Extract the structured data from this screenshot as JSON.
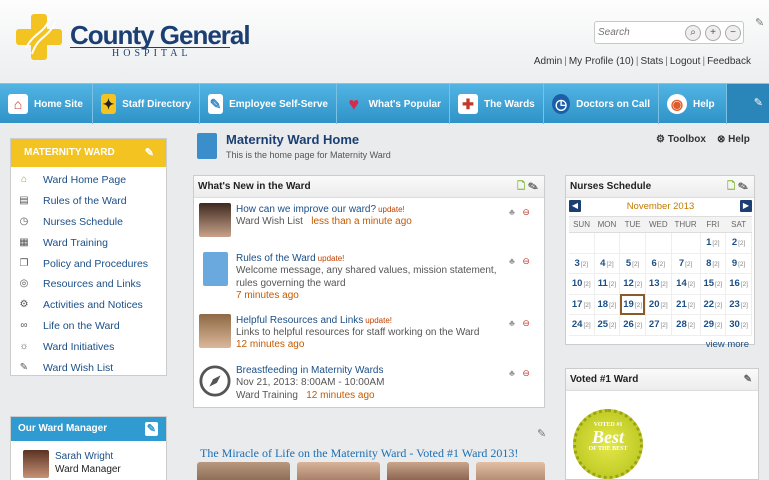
{
  "brand": {
    "name_line1": "County General",
    "name_line2": "HOSPITAL",
    "logo_color": "#f3c321"
  },
  "search": {
    "placeholder": "Search"
  },
  "user_links": [
    "Admin",
    "My Profile (10)",
    "Stats",
    "Logout",
    "Feedback"
  ],
  "nav": {
    "items": [
      {
        "label": "Home Site",
        "icon": "house-icon"
      },
      {
        "label": "Staff Directory",
        "icon": "person-walking-icon"
      },
      {
        "label": "Employee Self-Serve",
        "icon": "pencil-paper-icon"
      },
      {
        "label": "What's Popular",
        "icon": "heart-icon"
      },
      {
        "label": "The Wards",
        "icon": "medical-kit-icon"
      },
      {
        "label": "Doctors on Call",
        "icon": "clock-icon"
      },
      {
        "label": "Help",
        "icon": "lifebuoy-icon"
      }
    ]
  },
  "ward_menu": {
    "title": "MATERNITY WARD",
    "items": [
      {
        "label": "Ward Home Page",
        "icon": "home-icon"
      },
      {
        "label": "Rules of the Ward",
        "icon": "document-icon"
      },
      {
        "label": "Nurses Schedule",
        "icon": "clock-icon"
      },
      {
        "label": "Ward Training",
        "icon": "calendar-icon"
      },
      {
        "label": "Policy and Procedures",
        "icon": "stack-icon"
      },
      {
        "label": "Resources and Links",
        "icon": "globe-icon"
      },
      {
        "label": "Activities and Notices",
        "icon": "gear-icon"
      },
      {
        "label": "Life on the Ward",
        "icon": "binoculars-icon"
      },
      {
        "label": "Ward Initiatives",
        "icon": "sun-icon"
      },
      {
        "label": "Ward Wish List",
        "icon": "pencil-icon"
      }
    ]
  },
  "ward_manager": {
    "title": "Our Ward Manager",
    "name": "Sarah Wright",
    "role": "Ward Manager"
  },
  "page": {
    "title": "Maternity Ward Home",
    "subtitle": "This is the home page for Maternity Ward",
    "toolbox_label": "Toolbox",
    "help_label": "Help"
  },
  "whats_new": {
    "title": "What's New in the Ward",
    "update_tag": "update!",
    "items": [
      {
        "title": "How can we improve our ward?",
        "updated": true,
        "meta": "Ward Wish List",
        "time": "less than a minute ago",
        "time_inline": true
      },
      {
        "title": "Rules of the Ward",
        "updated": true,
        "meta": "Welcome message, any shared values, mission statement, rules governing the ward",
        "time": "7 minutes ago",
        "time_inline": false
      },
      {
        "title": "Helpful Resources and Links",
        "updated": true,
        "meta": "Links to helpful resources for staff working on the Ward",
        "time": "12 minutes ago",
        "time_inline": false
      },
      {
        "title": "Breastfeeding in Maternity Wards",
        "updated": false,
        "meta": "Nov 21, 2013: 8:00AM - 10:00AM",
        "meta2": "Ward Training",
        "time": "12 minutes ago",
        "time_inline": true
      }
    ]
  },
  "nurses_schedule": {
    "title": "Nurses Schedule",
    "month": "November 2013",
    "days": [
      "SUN",
      "MON",
      "TUE",
      "WED",
      "THUR",
      "FRI",
      "SAT"
    ],
    "today": 19,
    "weeks": [
      [
        null,
        null,
        null,
        null,
        null,
        1,
        2
      ],
      [
        3,
        4,
        5,
        6,
        7,
        8,
        9
      ],
      [
        10,
        11,
        12,
        13,
        14,
        15,
        16
      ],
      [
        17,
        18,
        19,
        20,
        21,
        22,
        23
      ],
      [
        24,
        25,
        26,
        27,
        28,
        29,
        30
      ]
    ],
    "count_label": "[2]",
    "view_more": "view more"
  },
  "voted": {
    "title": "Voted #1 Ward",
    "seal_top": "VOTED #1",
    "seal_mid": "Best",
    "seal_bottom": "OF THE BEST"
  },
  "feature": {
    "headline": "The Miracle of Life on the Maternity Ward - Voted #1 Ward 2013!"
  },
  "colors": {
    "nav_blue": "#2f93c8",
    "ward_yellow": "#f3c321",
    "link_blue": "#1b4f87",
    "time_orange": "#c45a00"
  }
}
